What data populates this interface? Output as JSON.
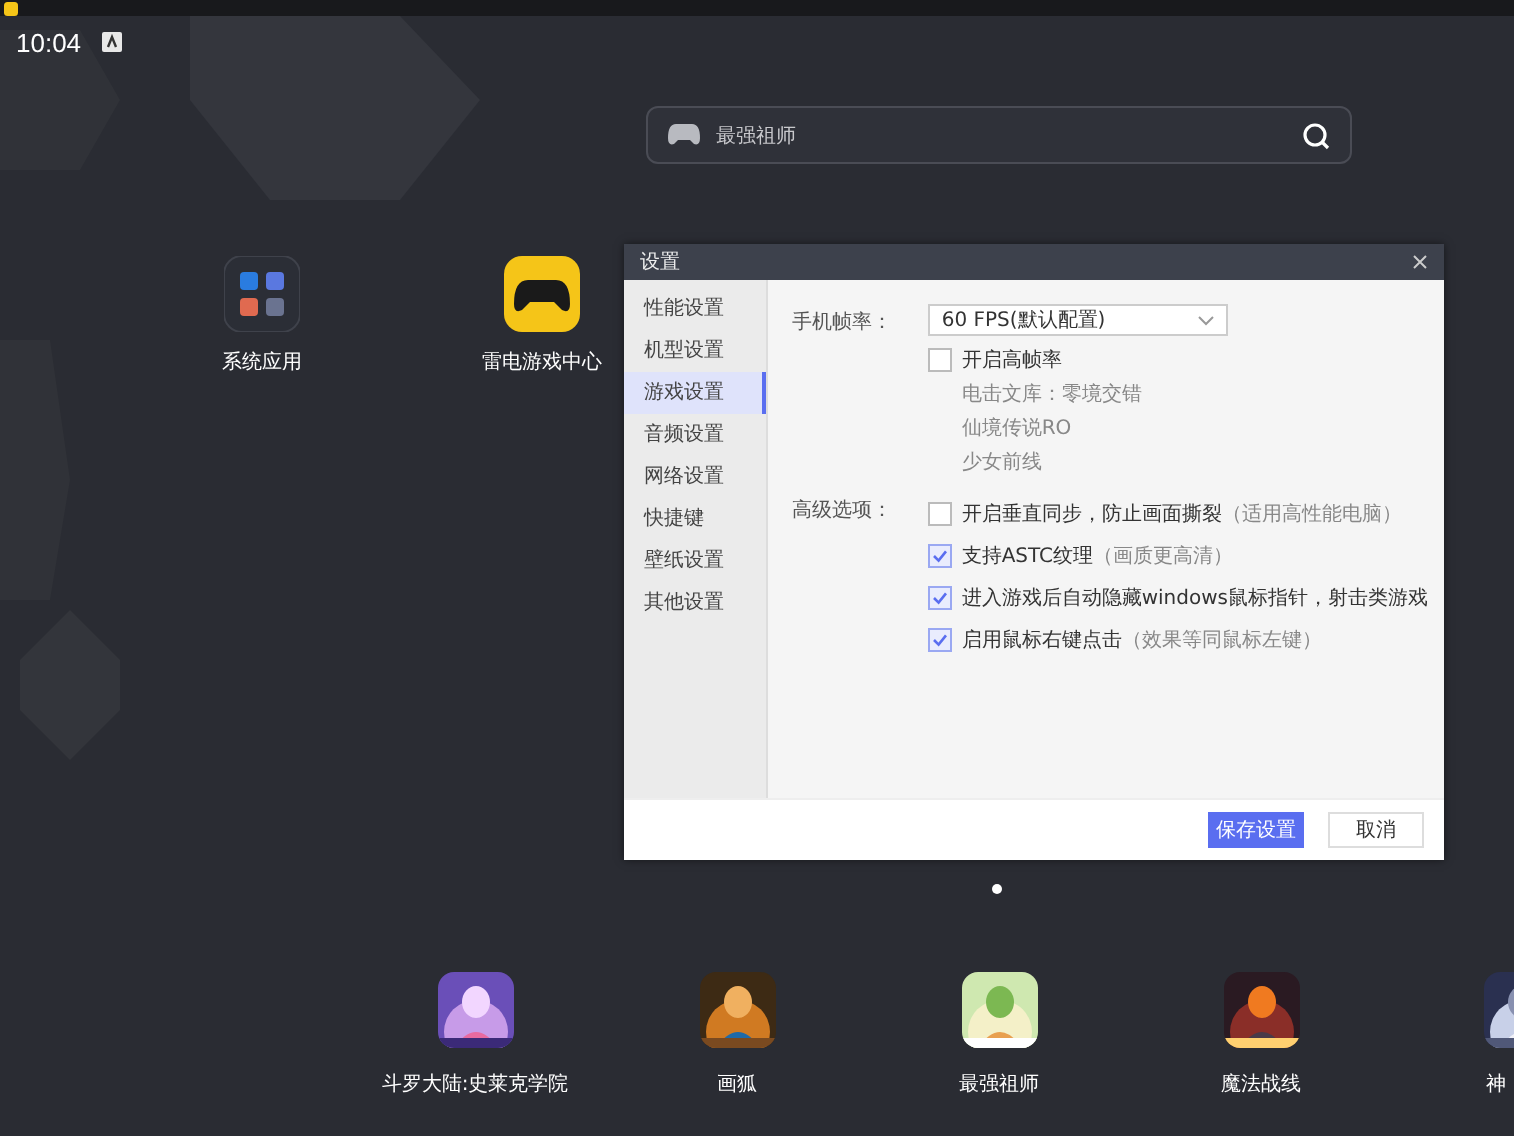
{
  "status_bar": {
    "time": "10:04"
  },
  "search": {
    "value": "最强祖师"
  },
  "desktop_icons": [
    {
      "label": "系统应用",
      "kind": "folder"
    },
    {
      "label": "雷电游戏中心",
      "kind": "gamepad"
    }
  ],
  "dialog": {
    "title": "设置",
    "sidebar": [
      {
        "label": "性能设置",
        "selected": false
      },
      {
        "label": "机型设置",
        "selected": false
      },
      {
        "label": "游戏设置",
        "selected": true
      },
      {
        "label": "音频设置",
        "selected": false
      },
      {
        "label": "网络设置",
        "selected": false
      },
      {
        "label": "快捷键",
        "selected": false
      },
      {
        "label": "壁纸设置",
        "selected": false
      },
      {
        "label": "其他设置",
        "selected": false
      }
    ],
    "fps_label": "手机帧率：",
    "fps_value": "60 FPS(默认配置)",
    "high_fps": {
      "label": "开启高帧率",
      "checked": false,
      "notes": [
        "电击文库：零境交错",
        "仙境传说RO",
        "少女前线"
      ]
    },
    "advanced_label": "高级选项：",
    "advanced": [
      {
        "label": "开启垂直同步，防止画面撕裂",
        "note": "（适用高性能电脑）",
        "checked": false
      },
      {
        "label": "支持ASTC纹理",
        "note": "（画质更高清）",
        "checked": true
      },
      {
        "label": "进入游戏后自动隐藏windows鼠标指针，射击类游戏",
        "checked": true
      },
      {
        "label": "启用鼠标右键点击",
        "note": "（效果等同鼠标左键）",
        "checked": true
      }
    ],
    "buttons": [
      {
        "label": "保存设置",
        "kind": "primary"
      },
      {
        "label": "取消",
        "kind": "secondary"
      }
    ]
  },
  "pages": [
    {
      "selected": true
    }
  ],
  "dock": [
    {
      "label": "斗罗大陆:史莱克学院"
    },
    {
      "label": "画狐"
    },
    {
      "label": "最强祖师"
    },
    {
      "label": "魔法战线"
    },
    {
      "label": "神"
    }
  ]
}
